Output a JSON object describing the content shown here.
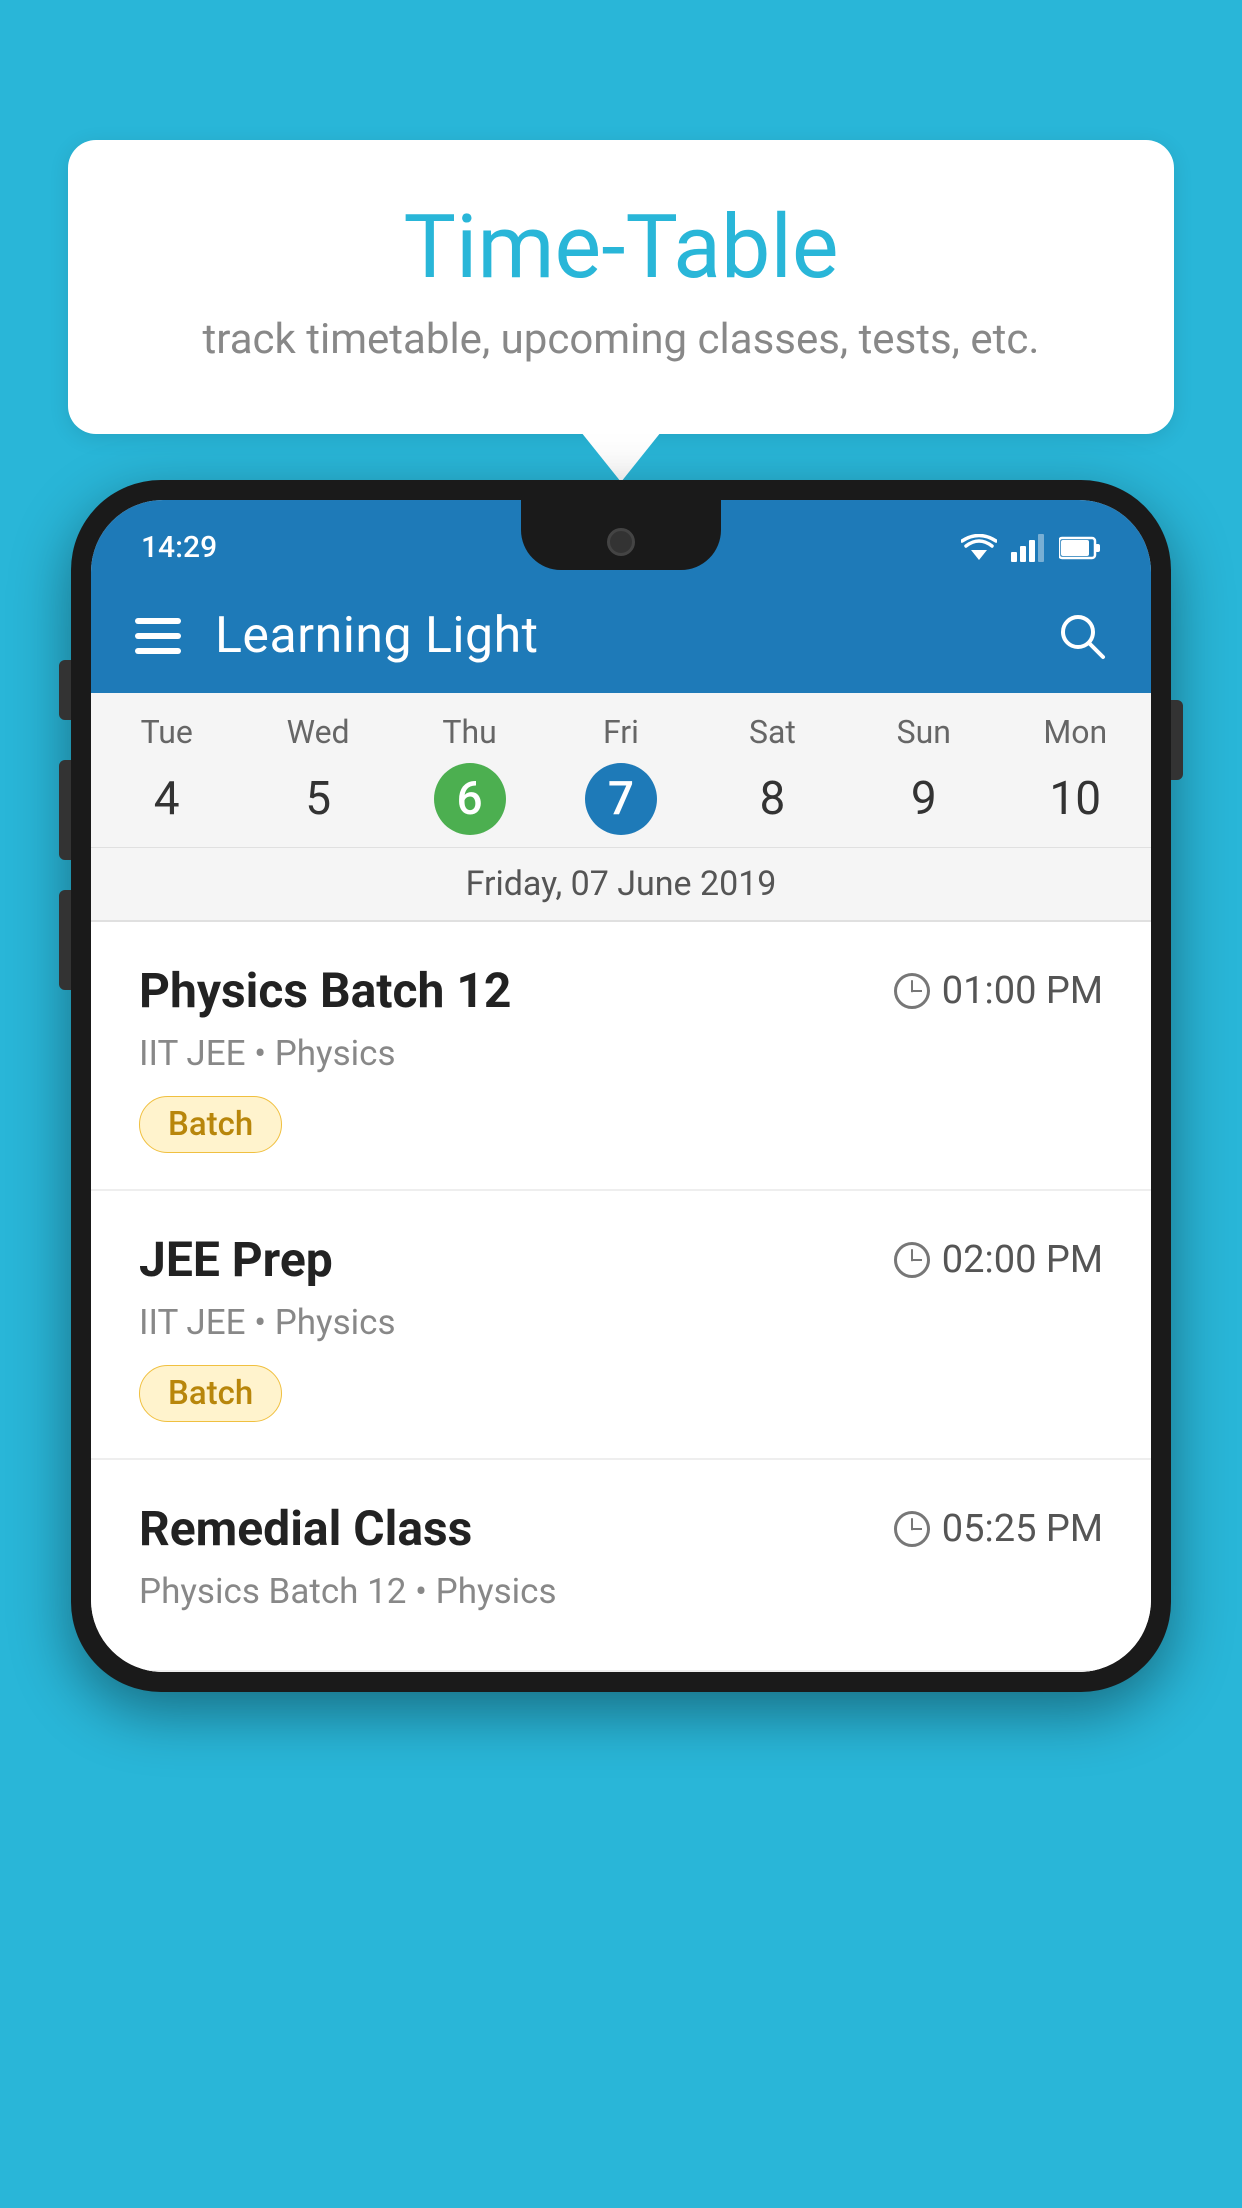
{
  "background_color": "#29b6d8",
  "bubble": {
    "title": "Time-Table",
    "subtitle": "track timetable, upcoming classes, tests, etc."
  },
  "phone": {
    "status_bar": {
      "time": "14:29"
    },
    "toolbar": {
      "title": "Learning Light"
    },
    "calendar": {
      "days": [
        {
          "name": "Tue",
          "num": "4",
          "state": "normal"
        },
        {
          "name": "Wed",
          "num": "5",
          "state": "normal"
        },
        {
          "name": "Thu",
          "num": "6",
          "state": "today"
        },
        {
          "name": "Fri",
          "num": "7",
          "state": "selected"
        },
        {
          "name": "Sat",
          "num": "8",
          "state": "normal"
        },
        {
          "name": "Sun",
          "num": "9",
          "state": "normal"
        },
        {
          "name": "Mon",
          "num": "10",
          "state": "normal"
        }
      ],
      "selected_date_label": "Friday, 07 June 2019"
    },
    "classes": [
      {
        "name": "Physics Batch 12",
        "time": "01:00 PM",
        "meta": "IIT JEE • Physics",
        "badge": "Batch"
      },
      {
        "name": "JEE Prep",
        "time": "02:00 PM",
        "meta": "IIT JEE • Physics",
        "badge": "Batch"
      },
      {
        "name": "Remedial Class",
        "time": "05:25 PM",
        "meta": "Physics Batch 12 • Physics",
        "badge": null
      }
    ]
  }
}
